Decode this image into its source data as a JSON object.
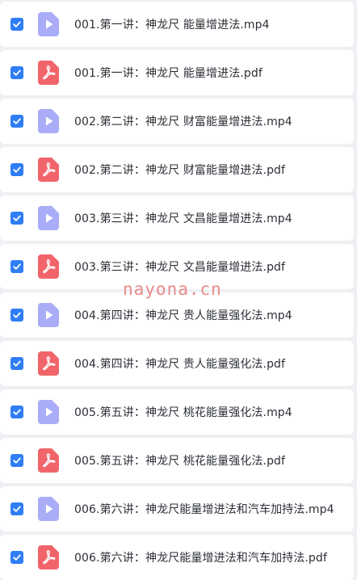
{
  "colors": {
    "checkbox": "#2f7ef6",
    "video_icon": "#a9adf7",
    "pdf_icon": "#f1656a",
    "row_background": "#ffffff",
    "page_background": "#eef0f4",
    "watermark": "#e88a8a"
  },
  "watermark": "nayona.cn",
  "files": [
    {
      "name": "001.第一讲：神龙尺 能量增进法.mp4",
      "type": "video",
      "icon": "video-file-icon",
      "checked": true
    },
    {
      "name": "001.第一讲：神龙尺 能量增进法.pdf",
      "type": "pdf",
      "icon": "pdf-file-icon",
      "checked": true
    },
    {
      "name": "002.第二讲：神龙尺 财富能量增进法.mp4",
      "type": "video",
      "icon": "video-file-icon",
      "checked": true
    },
    {
      "name": "002.第二讲：神龙尺 财富能量增进法.pdf",
      "type": "pdf",
      "icon": "pdf-file-icon",
      "checked": true
    },
    {
      "name": "003.第三讲：神龙尺 文昌能量增进法.mp4",
      "type": "video",
      "icon": "video-file-icon",
      "checked": true
    },
    {
      "name": "003.第三讲：神龙尺 文昌能量增进法.pdf",
      "type": "pdf",
      "icon": "pdf-file-icon",
      "checked": true
    },
    {
      "name": "004.第四讲：神龙尺 贵人能量强化法.mp4",
      "type": "video",
      "icon": "video-file-icon",
      "checked": true
    },
    {
      "name": "004.第四讲：神龙尺 贵人能量强化法.pdf",
      "type": "pdf",
      "icon": "pdf-file-icon",
      "checked": true
    },
    {
      "name": "005.第五讲：神龙尺 桃花能量强化法.mp4",
      "type": "video",
      "icon": "video-file-icon",
      "checked": true
    },
    {
      "name": "005.第五讲：神龙尺 桃花能量强化法.pdf",
      "type": "pdf",
      "icon": "pdf-file-icon",
      "checked": true
    },
    {
      "name": "006.第六讲：神龙尺能量增进法和汽车加持法.mp4",
      "type": "video",
      "icon": "video-file-icon",
      "checked": true
    },
    {
      "name": "006.第六讲：神龙尺能量增进法和汽车加持法.pdf",
      "type": "pdf",
      "icon": "pdf-file-icon",
      "checked": true
    }
  ]
}
